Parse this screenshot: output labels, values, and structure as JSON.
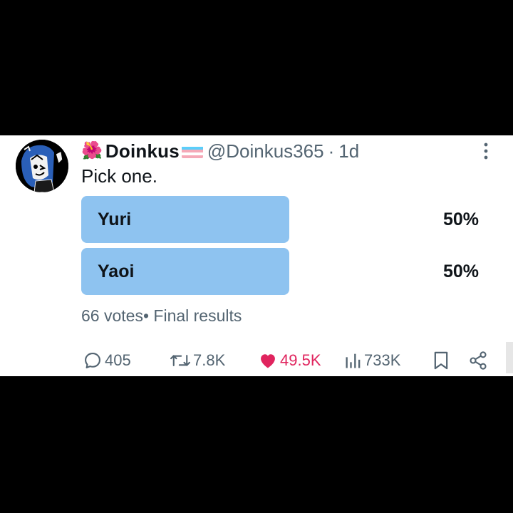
{
  "tweet": {
    "author_emoji": "🌺",
    "author_name": "Doinkus",
    "author_handle": "@Doinkus365",
    "separator": "·",
    "time": "1d",
    "text": "Pick one.",
    "poll": {
      "options": [
        {
          "label": "Yuri",
          "percent_label": "50%",
          "fraction": 0.5
        },
        {
          "label": "Yaoi",
          "percent_label": "50%",
          "fraction": 0.5
        }
      ],
      "votes_text": "66 votes",
      "bullet": "•",
      "status_text": "Final results"
    },
    "actions": {
      "replies": "405",
      "reposts": "7.8K",
      "likes": "49.5K",
      "views": "733K"
    }
  },
  "colors": {
    "poll_bar": "#8ec3f0",
    "like_accent": "#e0245e",
    "muted_text": "#536471",
    "primary_text": "#0f1419"
  },
  "icons": {
    "more": "more-vertical-icon",
    "reply": "reply-icon",
    "repost": "repost-icon",
    "like": "heart-icon",
    "views": "views-chart-icon",
    "bookmark": "bookmark-icon",
    "share": "share-icon"
  }
}
